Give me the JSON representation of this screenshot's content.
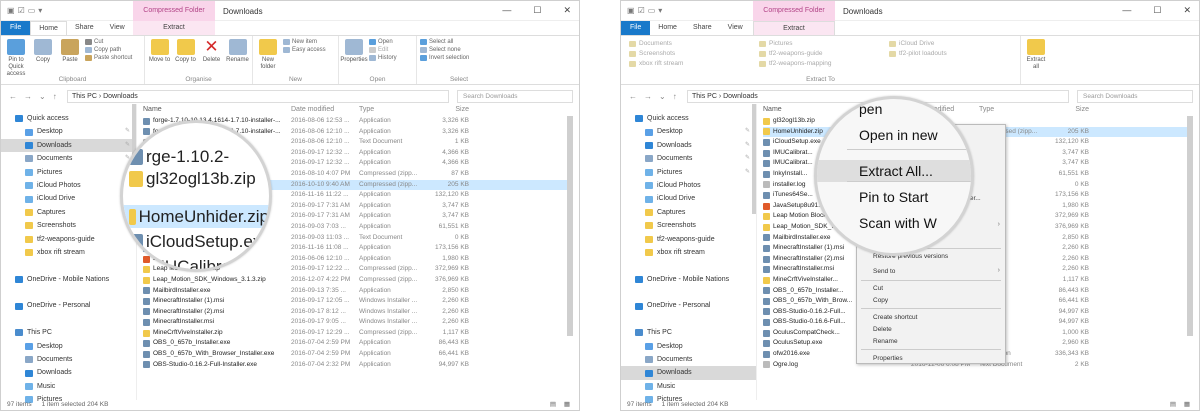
{
  "left": {
    "title": "Downloads",
    "context_tab": "Compressed Folder Tools",
    "tabs": [
      "File",
      "Home",
      "Share",
      "View",
      "Extract"
    ],
    "ribbon": {
      "clipboard": {
        "label": "Clipboard",
        "pin": "Pin to Quick access",
        "copy": "Copy",
        "paste": "Paste",
        "cut": "Cut",
        "copy_path": "Copy path",
        "paste_shortcut": "Paste shortcut"
      },
      "organise": {
        "label": "Organise",
        "move_to": "Move to",
        "copy_to": "Copy to",
        "delete": "Delete",
        "rename": "Rename"
      },
      "new": {
        "label": "New",
        "new_folder": "New folder",
        "new_item": "New item",
        "easy_access": "Easy access"
      },
      "open": {
        "label": "Open",
        "properties": "Properties",
        "open": "Open",
        "edit": "Edit",
        "history": "History"
      },
      "select": {
        "label": "Select",
        "select_all": "Select all",
        "select_none": "Select none",
        "invert": "Invert selection"
      }
    },
    "path": "This PC  ›  Downloads",
    "search_placeholder": "Search Downloads",
    "nav": [
      {
        "label": "Quick access",
        "color": "#2f86d6",
        "pin": ""
      },
      {
        "label": "Desktop",
        "color": "#5aa0e6",
        "pin": "✎"
      },
      {
        "label": "Downloads",
        "color": "#2f86d6",
        "pin": "✎",
        "selected": true
      },
      {
        "label": "Documents",
        "color": "#8aa7c7",
        "pin": "✎"
      },
      {
        "label": "Pictures",
        "color": "#6fb2e8",
        "pin": "✎"
      },
      {
        "label": "iCloud Photos",
        "color": "#6fb2e8",
        "pin": ""
      },
      {
        "label": "iCloud Drive",
        "color": "#6fb2e8",
        "pin": ""
      },
      {
        "label": "Captures",
        "color": "#f1c94b",
        "pin": ""
      },
      {
        "label": "Screenshots",
        "color": "#f1c94b",
        "pin": ""
      },
      {
        "label": "tf2-weapons-guide",
        "color": "#f1c94b",
        "pin": ""
      },
      {
        "label": "xbox rift stream",
        "color": "#f1c94b",
        "pin": ""
      },
      {
        "label": "",
        "color": "transparent",
        "pin": ""
      },
      {
        "label": "OneDrive - Mobile Nations",
        "color": "#2f86d6",
        "pin": ""
      },
      {
        "label": "",
        "color": "transparent",
        "pin": ""
      },
      {
        "label": "OneDrive - Personal",
        "color": "#2f86d6",
        "pin": ""
      },
      {
        "label": "",
        "color": "transparent",
        "pin": ""
      },
      {
        "label": "This PC",
        "color": "#4a8ccd",
        "pin": ""
      },
      {
        "label": "Desktop",
        "color": "#5aa0e6",
        "pin": ""
      },
      {
        "label": "Documents",
        "color": "#8aa7c7",
        "pin": ""
      },
      {
        "label": "Downloads",
        "color": "#2f86d6",
        "pin": ""
      },
      {
        "label": "Music",
        "color": "#6fb2e8",
        "pin": ""
      },
      {
        "label": "Pictures",
        "color": "#6fb2e8",
        "pin": ""
      },
      {
        "label": "Videos",
        "color": "#6fb2e8",
        "pin": ""
      }
    ],
    "columns": {
      "name": "Name",
      "date": "Date modified",
      "type": "Type",
      "size": "Size"
    },
    "rows": [
      {
        "name": "forge-1.7.10-10.13.4.1614-1.7.10-installer-...",
        "date": "2016-08-06 12:53 ...",
        "type": "Application",
        "size": "3,326 KB",
        "color": "#6e8fb0"
      },
      {
        "name": "forge-1.7.10-10.13.4.1614-1.7.10-installer-...",
        "date": "2016-08-06 12:10 ...",
        "type": "Application",
        "size": "3,326 KB",
        "color": "#6e8fb0"
      },
      {
        "name": "forge-1.10.2-...installer-...",
        "date": "2016-08-06 12:10 ...",
        "type": "Text Document",
        "size": "1 KB",
        "color": "#bbbbbb"
      },
      {
        "name": "gl32ogl13b.zip ...ller-win.exe",
        "date": "2016-09-17 12:32 ...",
        "type": "Application",
        "size": "4,366 KB",
        "color": "#f1c94b"
      },
      {
        "name": "...ller-win.exe",
        "date": "2016-09-17 12:32 ...",
        "type": "Application",
        "size": "4,366 KB",
        "color": "#6e8fb0"
      },
      {
        "name": "",
        "date": "2016-08-10 4:07 PM",
        "type": "Compressed (zipp...",
        "size": "87 KB",
        "color": "#f1c94b"
      },
      {
        "name": "HomeUnhider.zip",
        "date": "2016-10-10 9:40 AM",
        "type": "Compressed (zipp...",
        "size": "205 KB",
        "color": "#f1c94b",
        "selected": true
      },
      {
        "name": "",
        "date": "2016-11-16 11:22 ...",
        "type": "Application",
        "size": "132,120 KB",
        "color": "#6e8fb0"
      },
      {
        "name": "",
        "date": "2016-09-17 7:31 AM",
        "type": "Application",
        "size": "3,747 KB",
        "color": "#6e8fb0"
      },
      {
        "name": "",
        "date": "2016-09-17 7:31 AM",
        "type": "Application",
        "size": "3,747 KB",
        "color": "#6e8fb0"
      },
      {
        "name": "...77.exe",
        "date": "2016-09-03 7:03 ...",
        "type": "Application",
        "size": "61,551 KB",
        "color": "#6e8fb0"
      },
      {
        "name": "",
        "date": "2016-09-03 11:03 ...",
        "type": "Text Document",
        "size": "0 KB",
        "color": "#bbbbbb"
      },
      {
        "name": "iTunes64Setup.exe",
        "date": "2016-11-16 11:08 ...",
        "type": "Application",
        "size": "173,156 KB",
        "color": "#6e8fb0"
      },
      {
        "name": "JavaSetup8u91.exe",
        "date": "2016-06-06 12:10 ...",
        "type": "Application",
        "size": "1,980 KB",
        "color": "#e05a2a"
      },
      {
        "name": "Leap Motion Blocks.zip",
        "date": "2016-09-17 12:22 ...",
        "type": "Compressed (zipp...",
        "size": "372,969 KB",
        "color": "#f1c94b"
      },
      {
        "name": "Leap_Motion_SDK_Windows_3.1.3.zip",
        "date": "2016-12-07 4:22 PM",
        "type": "Compressed (zipp...",
        "size": "376,969 KB",
        "color": "#f1c94b"
      },
      {
        "name": "MailbirdInstaller.exe",
        "date": "2016-09-13 7:35 ...",
        "type": "Application",
        "size": "2,850 KB",
        "color": "#6e8fb0"
      },
      {
        "name": "MinecraftInstaller (1).msi",
        "date": "2016-09-17 12:05 ...",
        "type": "Windows Installer ...",
        "size": "2,260 KB",
        "color": "#6e8fb0"
      },
      {
        "name": "MinecraftInstaller (2).msi",
        "date": "2016-09-17 8:12 ...",
        "type": "Windows Installer ...",
        "size": "2,260 KB",
        "color": "#6e8fb0"
      },
      {
        "name": "MinecraftInstaller.msi",
        "date": "2016-09-17 9:05 ...",
        "type": "Windows Installer ...",
        "size": "2,260 KB",
        "color": "#6e8fb0"
      },
      {
        "name": "MineCrftViveInstaller.zip",
        "date": "2016-09-17 12:29 ...",
        "type": "Compressed (zipp...",
        "size": "1,117 KB",
        "color": "#f1c94b"
      },
      {
        "name": "OBS_0_657b_Installer.exe",
        "date": "2016-07-04 2:59 PM",
        "type": "Application",
        "size": "86,443 KB",
        "color": "#6e8fb0"
      },
      {
        "name": "OBS_0_657b_With_Browser_Installer.exe",
        "date": "2016-07-04 2:59 PM",
        "type": "Application",
        "size": "66,441 KB",
        "color": "#6e8fb0"
      },
      {
        "name": "OBS-Studio-0.16.2-Full-Installer.exe",
        "date": "2016-07-04 2:32 PM",
        "type": "Application",
        "size": "94,997 KB",
        "color": "#6e8fb0"
      }
    ],
    "magnifier": [
      {
        "text": "rge-1.10.2-",
        "color": "#6e8fb0",
        "selected": false
      },
      {
        "text": "gl32ogl13b.zip",
        "color": "#f1c94b",
        "selected": false
      },
      {
        "text": "HomeUnhider.zip",
        "color": "#f1c94b",
        "selected": true
      },
      {
        "text": "iCloudSetup.exe",
        "color": "#6e8fb0",
        "selected": false
      },
      {
        "text": "IMUCalibration",
        "color": "#6e8fb0",
        "selected": false
      }
    ],
    "status": {
      "items": "97 items",
      "selected": "1 item selected  204 KB",
      "view_icons": "▤ ▦"
    }
  },
  "right": {
    "title": "Downloads",
    "context_tab": "Compressed Folder Tools",
    "tabs": [
      "File",
      "Home",
      "Share",
      "View",
      "Extract"
    ],
    "ribbon": {
      "extract_to_label": "Extract To",
      "extract_all": "Extract all",
      "destinations": [
        "Documents",
        "Screenshots",
        "xbox rift stream",
        "Pictures",
        "tf2-weapons-guide",
        "tf2-weapons-mapping",
        "iCloud Drive",
        "tf2-pilot loadouts"
      ]
    },
    "path": "This PC  ›  Downloads",
    "search_placeholder": "Search Downloads",
    "nav": [
      {
        "label": "Quick access",
        "color": "#2f86d6",
        "pin": ""
      },
      {
        "label": "Desktop",
        "color": "#5aa0e6",
        "pin": "✎"
      },
      {
        "label": "Downloads",
        "color": "#2f86d6",
        "pin": "✎"
      },
      {
        "label": "Documents",
        "color": "#8aa7c7",
        "pin": "✎"
      },
      {
        "label": "Pictures",
        "color": "#6fb2e8",
        "pin": "✎"
      },
      {
        "label": "iCloud Photos",
        "color": "#6fb2e8",
        "pin": ""
      },
      {
        "label": "iCloud Drive",
        "color": "#6fb2e8",
        "pin": ""
      },
      {
        "label": "Captures",
        "color": "#f1c94b",
        "pin": ""
      },
      {
        "label": "Screenshots",
        "color": "#f1c94b",
        "pin": ""
      },
      {
        "label": "tf2-weapons-guide",
        "color": "#f1c94b",
        "pin": ""
      },
      {
        "label": "xbox rift stream",
        "color": "#f1c94b",
        "pin": ""
      },
      {
        "label": "",
        "color": "transparent",
        "pin": ""
      },
      {
        "label": "OneDrive - Mobile Nations",
        "color": "#2f86d6",
        "pin": ""
      },
      {
        "label": "",
        "color": "transparent",
        "pin": ""
      },
      {
        "label": "OneDrive - Personal",
        "color": "#2f86d6",
        "pin": ""
      },
      {
        "label": "",
        "color": "transparent",
        "pin": ""
      },
      {
        "label": "This PC",
        "color": "#4a8ccd",
        "pin": ""
      },
      {
        "label": "Desktop",
        "color": "#5aa0e6",
        "pin": ""
      },
      {
        "label": "Documents",
        "color": "#8aa7c7",
        "pin": ""
      },
      {
        "label": "Downloads",
        "color": "#2f86d6",
        "pin": "",
        "selected": true
      },
      {
        "label": "Music",
        "color": "#6fb2e8",
        "pin": ""
      },
      {
        "label": "Pictures",
        "color": "#6fb2e8",
        "pin": ""
      },
      {
        "label": "Videos",
        "color": "#6fb2e8",
        "pin": ""
      }
    ],
    "columns": {
      "name": "Name",
      "date": "Date modified",
      "type": "Type",
      "size": "Size"
    },
    "rows": [
      {
        "name": "gl32ogl13b.zip",
        "date": "",
        "type": "",
        "size": "",
        "color": "#f1c94b"
      },
      {
        "name": "HomeUnhider.zip",
        "date": "2016-10-10 9:40 AM",
        "type": "Compressed (zipp...",
        "size": "205 KB",
        "color": "#f1c94b",
        "selected": true
      },
      {
        "name": "iCloudSetup.exe",
        "date": "",
        "type": "",
        "size": "132,120 KB",
        "color": "#6e8fb0"
      },
      {
        "name": "IMUCalibrat...",
        "date": "",
        "type": "",
        "size": "3,747 KB",
        "color": "#6e8fb0"
      },
      {
        "name": "IMUCalibrat...",
        "date": "",
        "type": "",
        "size": "3,747 KB",
        "color": "#6e8fb0"
      },
      {
        "name": "InkyInstall...",
        "date": "",
        "type": "",
        "size": "61,551 KB",
        "color": "#6e8fb0"
      },
      {
        "name": "installer.log",
        "date": "",
        "type": "",
        "size": "0 KB",
        "color": "#bbbbbb"
      },
      {
        "name": "iTunes64Se...",
        "date": "",
        "type": "",
        "size": "173,156 KB",
        "color": "#6e8fb0"
      },
      {
        "name": "JavaSetup8u91.exe",
        "date": "",
        "type": "",
        "size": "1,980 KB",
        "color": "#e05a2a"
      },
      {
        "name": "Leap Motion Blocks...",
        "date": "",
        "type": "",
        "size": "372,969 KB",
        "color": "#f1c94b"
      },
      {
        "name": "Leap_Motion_SDK_Wi...",
        "date": "",
        "type": "",
        "size": "376,969 KB",
        "color": "#f1c94b"
      },
      {
        "name": "MailbirdInstaller.exe",
        "date": "",
        "type": "",
        "size": "2,850 KB",
        "color": "#6e8fb0"
      },
      {
        "name": "MinecraftInstaller (1).msi",
        "date": "",
        "type": "",
        "size": "2,260 KB",
        "color": "#6e8fb0"
      },
      {
        "name": "MinecraftInstaller (2).msi",
        "date": "",
        "type": "",
        "size": "2,260 KB",
        "color": "#6e8fb0"
      },
      {
        "name": "MinecraftInstaller.msi",
        "date": "",
        "type": "",
        "size": "2,260 KB",
        "color": "#6e8fb0"
      },
      {
        "name": "MineCrftViveInstaller...",
        "date": "",
        "type": "",
        "size": "1,117 KB",
        "color": "#f1c94b"
      },
      {
        "name": "OBS_0_657b_Installer...",
        "date": "",
        "type": "",
        "size": "86,443 KB",
        "color": "#6e8fb0"
      },
      {
        "name": "OBS_0_657b_With_Brow...",
        "date": "",
        "type": "",
        "size": "66,441 KB",
        "color": "#6e8fb0"
      },
      {
        "name": "OBS-Studio-0.16.2-Full...",
        "date": "",
        "type": "",
        "size": "94,997 KB",
        "color": "#6e8fb0"
      },
      {
        "name": "OBS-Studio-0.16.6-Full...",
        "date": "",
        "type": "",
        "size": "94,997 KB",
        "color": "#6e8fb0"
      },
      {
        "name": "OculusCompatCheck...",
        "date": "",
        "type": "",
        "size": "1,000 KB",
        "color": "#6e8fb0"
      },
      {
        "name": "OculusSetup.exe",
        "date": "",
        "type": "",
        "size": "2,960 KB",
        "color": "#6e8fb0"
      },
      {
        "name": "ofw2016.exe",
        "date": "2016-09-15 5:40 PM",
        "type": "Application",
        "size": "336,343 KB",
        "color": "#6e8fb0"
      },
      {
        "name": "Ogre.log",
        "date": "2016-12-06 6:08 PM",
        "type": "Text Document",
        "size": "2 KB",
        "color": "#bbbbbb"
      }
    ],
    "context_menu": [
      {
        "label": "ASUS Secure Delete",
        "arrow": ""
      },
      {
        "label": "Restore previous versions",
        "arrow": ""
      },
      {
        "label": "Send to",
        "arrow": "›"
      },
      {
        "label": "Cut",
        "arrow": ""
      },
      {
        "label": "Copy",
        "arrow": ""
      },
      {
        "label": "Create shortcut",
        "arrow": ""
      },
      {
        "label": "Delete",
        "arrow": ""
      },
      {
        "label": "Rename",
        "arrow": ""
      },
      {
        "label": "Properties",
        "arrow": ""
      }
    ],
    "context_menu_extra": [
      "...ler..."
    ],
    "magnifier": [
      {
        "text": "pen",
        "highlight": false
      },
      {
        "text": "Open in new",
        "highlight": false
      },
      {
        "text": "Extract All...",
        "highlight": true
      },
      {
        "text": "Pin to Start",
        "highlight": false
      },
      {
        "text": "Scan with W",
        "highlight": false
      }
    ],
    "status": {
      "items": "97 items",
      "selected": "1 item selected  204 KB",
      "view_icons": "▤ ▦"
    }
  }
}
